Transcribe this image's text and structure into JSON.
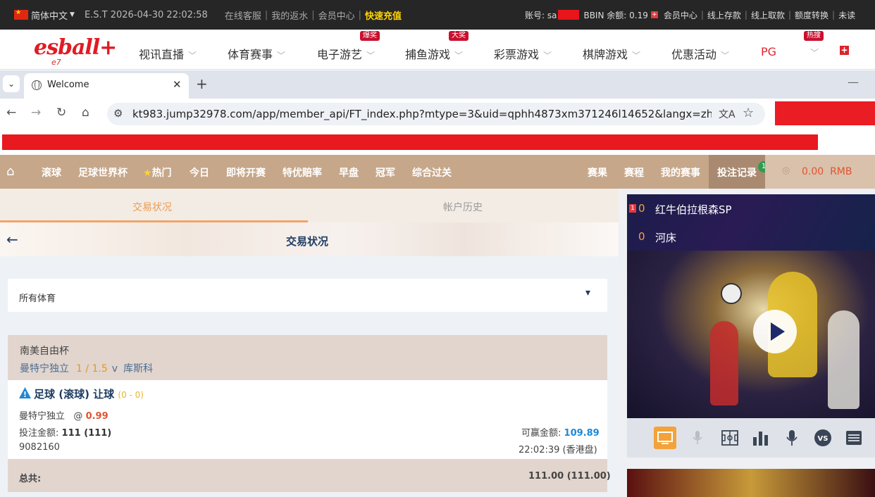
{
  "topbar": {
    "language": "简体中文",
    "est_time": "E.S.T 2026-04-30 22:02:58",
    "links": [
      "在线客服",
      "我的返水",
      "会员中心"
    ],
    "recharge": "快速充值",
    "account_label": "账号: sa",
    "balance_label": "BBIN 余额: 0.19",
    "right_links": [
      "会员中心",
      "线上存款",
      "线上取款",
      "额度转换",
      "未读"
    ]
  },
  "site": {
    "logo": "esball+",
    "logo_sub": "e7",
    "nav": [
      {
        "label": "视讯直播",
        "badge": ""
      },
      {
        "label": "体育赛事",
        "badge": ""
      },
      {
        "label": "电子游艺",
        "badge": "爆奖"
      },
      {
        "label": "捕鱼游戏",
        "badge": "大奖"
      },
      {
        "label": "彩票游戏",
        "badge": ""
      },
      {
        "label": "棋牌游戏",
        "badge": ""
      },
      {
        "label": "优惠活动",
        "badge": ""
      },
      {
        "label": "PG",
        "badge": "热搜"
      }
    ]
  },
  "browser": {
    "tab_title": "Welcome",
    "url": "kt983.jump32978.com/app/member_api/FT_index.php?mtype=3&uid=qphh4873xm371246l14652&langx=zh-cn&news_..."
  },
  "sportnav": {
    "items": [
      "滚球",
      "足球世界杯",
      "热门",
      "今日",
      "即将开赛",
      "特优赔率",
      "早盘",
      "冠军",
      "综合过关"
    ],
    "right_items": [
      "赛果",
      "赛程",
      "我的赛事"
    ],
    "active": "投注记录",
    "active_count": "1",
    "balance": "0.00",
    "currency": "RMB"
  },
  "subtabs": [
    "交易状况",
    "帐户历史"
  ],
  "page_title": "交易状况",
  "filter": {
    "selected": "所有体育"
  },
  "bet": {
    "league": "南美自由杯",
    "home": "曼特宁独立",
    "handicap": "1 / 1.5",
    "vs": "v",
    "away": "库斯科",
    "type": "足球 (滚球) 让球",
    "score": "(0 - 0)",
    "selection": "曼特宁独立",
    "at": "@",
    "odds": "0.99",
    "stake_label": "投注金额:",
    "stake": "111 (111)",
    "win_label": "可赢金额:",
    "win": "109.89",
    "ticket": "9082160",
    "time": "22:02:39 (香港盘)"
  },
  "total": {
    "label": "总共:",
    "value": "111.00 (111.00)"
  },
  "live": {
    "team_a": "红牛伯拉根森SP",
    "score_a": "0",
    "red_card": "1",
    "team_b": "河床",
    "score_b": "0"
  },
  "colors": {
    "sport_nav": "#c6a78a",
    "accent_orange": "#f4a23a",
    "odds_red": "#e2542f",
    "win_blue": "#1e88d6"
  }
}
